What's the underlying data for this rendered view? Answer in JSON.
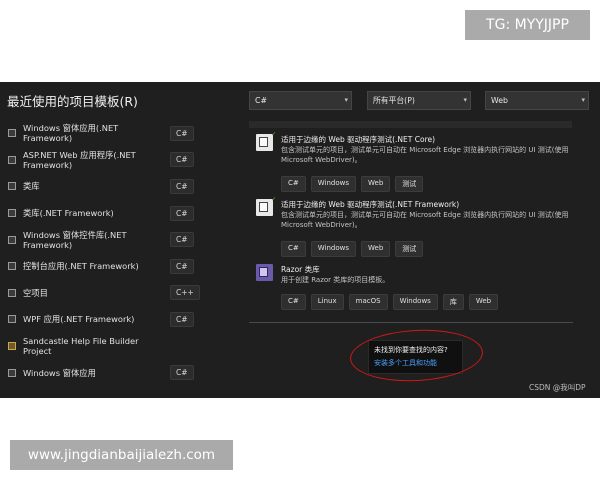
{
  "watermark_top": "TG: MYYJJPP",
  "watermark_bottom": "www.jingdianbaijialezh.com",
  "left_panel": {
    "title": "最近使用的项目模板(R)",
    "items": [
      {
        "label": "Windows 窗体应用(.NET Framework)",
        "lang": "C#",
        "icon": "winforms-icon"
      },
      {
        "label": "ASP.NET Web 应用程序(.NET Framework)",
        "lang": "C#",
        "icon": "web-app-icon"
      },
      {
        "label": "类库",
        "lang": "C#",
        "icon": "class-library-icon"
      },
      {
        "label": "类库(.NET Framework)",
        "lang": "C#",
        "icon": "class-library-icon"
      },
      {
        "label": "Windows 窗体控件库(.NET Framework)",
        "lang": "C#",
        "icon": "control-library-icon"
      },
      {
        "label": "控制台应用(.NET Framework)",
        "lang": "C#",
        "icon": "console-icon"
      },
      {
        "label": "空项目",
        "lang": "C++",
        "icon": "empty-project-icon"
      },
      {
        "label": "WPF 应用(.NET Framework)",
        "lang": "C#",
        "icon": "wpf-icon"
      },
      {
        "label": "Sandcastle Help File Builder Project",
        "lang": "",
        "icon": "sandcastle-icon"
      },
      {
        "label": "Windows 窗体应用",
        "lang": "C#",
        "icon": "winforms-icon"
      }
    ]
  },
  "filters": {
    "language": "C#",
    "platform": "所有平台(P)",
    "project_type": "Web"
  },
  "templates": [
    {
      "title": "适用于边缘的 Web 驱动程序测试(.NET Core)",
      "description": "包含测试单元的项目，测试单元可自动在 Microsoft Edge 浏览器内执行网站的 UI 测试(使用 Microsoft WebDriver)。",
      "tags": [
        "C#",
        "Windows",
        "Web",
        "测试"
      ]
    },
    {
      "title": "适用于边缘的 Web 驱动程序测试(.NET Framework)",
      "description": "包含测试单元的项目，测试单元可自动在 Microsoft Edge 浏览器内执行网站的 UI 测试(使用 Microsoft WebDriver)。",
      "tags": [
        "C#",
        "Windows",
        "Web",
        "测试"
      ]
    },
    {
      "title": "Razor 类库",
      "description": "用于创建 Razor 类库的项目模板。",
      "tags": [
        "C#",
        "Linux",
        "macOS",
        "Windows",
        "库",
        "Web"
      ]
    }
  ],
  "not_found": {
    "question": "未找到你要查找的内容?",
    "link": "安装多个工具和功能"
  },
  "credit": "CSDN @我叫DP",
  "colors": {
    "background": "#1f1f1f",
    "link": "#4aa3ff",
    "annotation_circle": "#d01818"
  }
}
